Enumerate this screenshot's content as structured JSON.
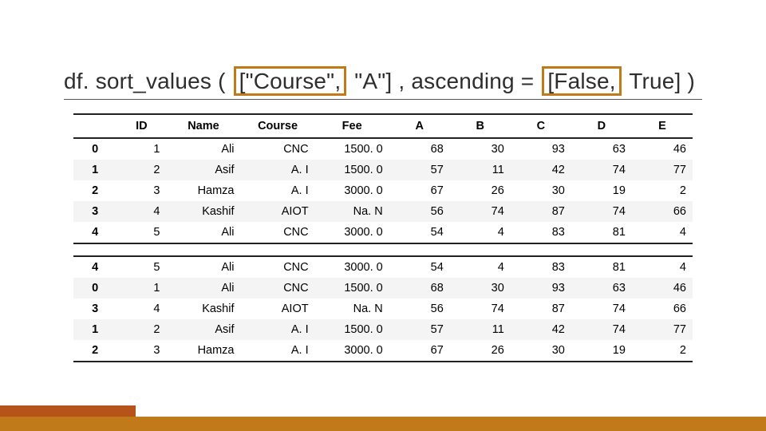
{
  "title_tokens": [
    {
      "t": "df. sort_values ( ",
      "boxed": false
    },
    {
      "t": "[\"Course\",",
      "boxed": true
    },
    {
      "t": " \"A\"] , ascending = ",
      "boxed": false
    },
    {
      "t": "[False,",
      "boxed": true
    },
    {
      "t": " True] )",
      "boxed": false
    }
  ],
  "columns": [
    "",
    "ID",
    "Name",
    "Course",
    "Fee",
    "A",
    "B",
    "C",
    "D",
    "E"
  ],
  "table1_rows": [
    [
      "0",
      "1",
      "Ali",
      "CNC",
      "1500. 0",
      "68",
      "30",
      "93",
      "63",
      "46"
    ],
    [
      "1",
      "2",
      "Asif",
      "A. I",
      "1500. 0",
      "57",
      "11",
      "42",
      "74",
      "77"
    ],
    [
      "2",
      "3",
      "Hamza",
      "A. I",
      "3000. 0",
      "67",
      "26",
      "30",
      "19",
      "2"
    ],
    [
      "3",
      "4",
      "Kashif",
      "AIOT",
      "Na. N",
      "56",
      "74",
      "87",
      "74",
      "66"
    ],
    [
      "4",
      "5",
      "Ali",
      "CNC",
      "3000. 0",
      "54",
      "4",
      "83",
      "81",
      "4"
    ]
  ],
  "table2_rows": [
    [
      "4",
      "5",
      "Ali",
      "CNC",
      "3000. 0",
      "54",
      "4",
      "83",
      "81",
      "4"
    ],
    [
      "0",
      "1",
      "Ali",
      "CNC",
      "1500. 0",
      "68",
      "30",
      "93",
      "63",
      "46"
    ],
    [
      "3",
      "4",
      "Kashif",
      "AIOT",
      "Na. N",
      "56",
      "74",
      "87",
      "74",
      "66"
    ],
    [
      "1",
      "2",
      "Asif",
      "A. I",
      "1500. 0",
      "57",
      "11",
      "42",
      "74",
      "77"
    ],
    [
      "2",
      "3",
      "Hamza",
      "A. I",
      "3000. 0",
      "67",
      "26",
      "30",
      "19",
      "2"
    ]
  ],
  "chart_data": [
    {
      "type": "table",
      "title": "Original DataFrame",
      "columns": [
        "ID",
        "Name",
        "Course",
        "Fee",
        "A",
        "B",
        "C",
        "D",
        "E"
      ],
      "index": [
        0,
        1,
        2,
        3,
        4
      ],
      "rows": [
        [
          1,
          "Ali",
          "CNC",
          1500.0,
          68,
          30,
          93,
          63,
          46
        ],
        [
          2,
          "Asif",
          "A. I",
          1500.0,
          57,
          11,
          42,
          74,
          77
        ],
        [
          3,
          "Hamza",
          "A. I",
          3000.0,
          67,
          26,
          30,
          19,
          2
        ],
        [
          4,
          "Kashif",
          "AIOT",
          null,
          56,
          74,
          87,
          74,
          66
        ],
        [
          5,
          "Ali",
          "CNC",
          3000.0,
          54,
          4,
          83,
          81,
          4
        ]
      ]
    },
    {
      "type": "table",
      "title": "df.sort_values([\"Course\", \"A\"], ascending=[False, True])",
      "columns": [
        "ID",
        "Name",
        "Course",
        "Fee",
        "A",
        "B",
        "C",
        "D",
        "E"
      ],
      "index": [
        4,
        0,
        3,
        1,
        2
      ],
      "rows": [
        [
          5,
          "Ali",
          "CNC",
          3000.0,
          54,
          4,
          83,
          81,
          4
        ],
        [
          1,
          "Ali",
          "CNC",
          1500.0,
          68,
          30,
          93,
          63,
          46
        ],
        [
          4,
          "Kashif",
          "AIOT",
          null,
          56,
          74,
          87,
          74,
          66
        ],
        [
          2,
          "Asif",
          "A. I",
          1500.0,
          57,
          11,
          42,
          74,
          77
        ],
        [
          3,
          "Hamza",
          "A. I",
          3000.0,
          67,
          26,
          30,
          19,
          2
        ]
      ]
    }
  ]
}
